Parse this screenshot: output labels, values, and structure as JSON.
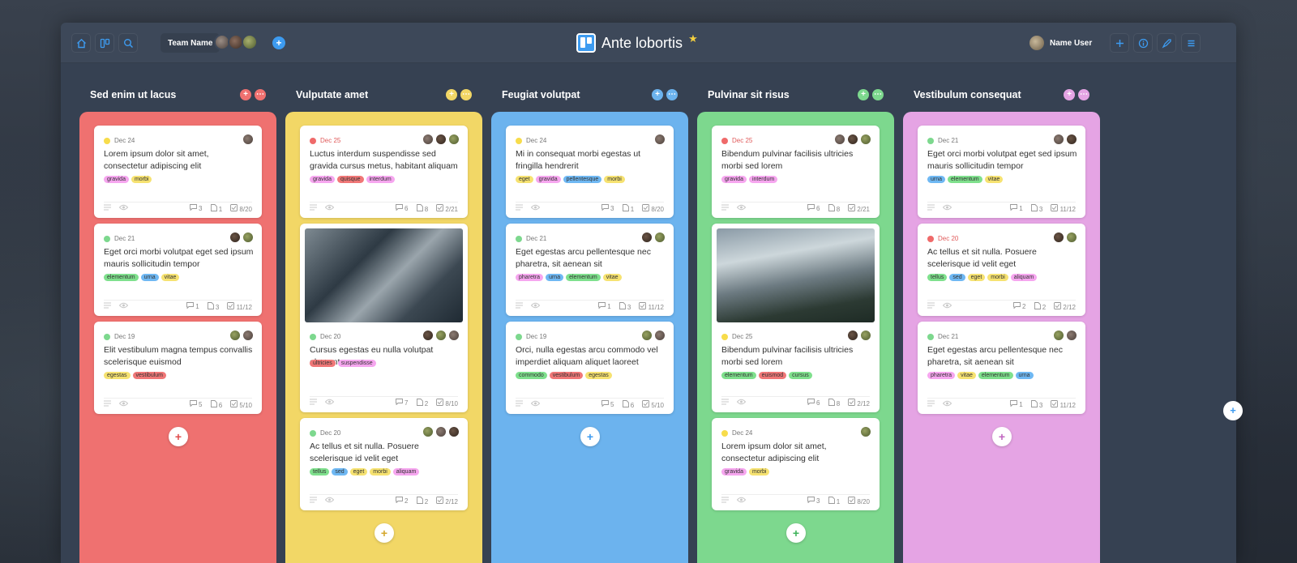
{
  "topbar": {
    "team_name": "Team Name",
    "board_title": "Ante lobortis",
    "user_name": "Name User"
  },
  "colors": {
    "accent": "#3d9bf0",
    "red": "#ef7170",
    "yellow": "#f2d766",
    "blue": "#6cb3ee",
    "green": "#7dd88e",
    "pink": "#e5a4e4"
  },
  "columns": [
    {
      "title": "Sed enim ut lacus",
      "color": "#ef7170",
      "cards": [
        {
          "date": "Dec 24",
          "dot": "#f7dc4b",
          "text": "Lorem ipsum dolor sit amet, consectetur adipiscing elit",
          "tags": [
            "gravida",
            "morbi"
          ],
          "stats": [
            "3",
            "1",
            "8/20"
          ]
        },
        {
          "date": "Dec 21",
          "dot": "#7dd88e",
          "text": "Eget orci morbi volutpat eget sed ipsum mauris sollicitudin tempor",
          "tags": [
            "elementum",
            "urna",
            "vitae"
          ],
          "stats": [
            "1",
            "3",
            "11/12"
          ]
        },
        {
          "date": "Dec 19",
          "dot": "#7dd88e",
          "text": "Elit vestibulum magna tempus convallis scelerisque euismod",
          "tags": [
            "egestas",
            "vestibulum"
          ],
          "stats": [
            "5",
            "6",
            "5/10"
          ]
        }
      ]
    },
    {
      "title": "Vulputate amet",
      "color": "#f2d766",
      "cards": [
        {
          "date": "Dec 25",
          "dot": "#ef6a6a",
          "text": "Luctus interdum suspendisse sed gravida cursus metus, habitant aliquam",
          "tags": [
            "gravida",
            "quisque",
            "interdum"
          ],
          "stats": [
            "6",
            "8",
            "2/21"
          ]
        },
        {
          "date": "Dec 20",
          "dot": "#7dd88e",
          "text": "Cursus egestas eu nulla volutpat elementum",
          "tags": [
            "ultricies",
            "suspendisse"
          ],
          "stats": [
            "7",
            "2",
            "8/10"
          ]
        },
        {
          "date": "Dec 20",
          "dot": "#7dd88e",
          "text": "Ac tellus et sit nulla. Posuere scelerisque id velit eget",
          "tags": [
            "tellus",
            "sed",
            "eget",
            "morbi",
            "aliquam"
          ],
          "stats": [
            "2",
            "2",
            "2/12"
          ]
        }
      ]
    },
    {
      "title": "Feugiat volutpat",
      "color": "#6cb3ee",
      "cards": [
        {
          "date": "Dec 24",
          "dot": "#f7dc4b",
          "text": "Mi in consequat morbi egestas ut fringilla hendrerit",
          "tags": [
            "eget",
            "gravida",
            "pellentesque",
            "morbi"
          ],
          "stats": [
            "3",
            "1",
            "8/20"
          ]
        },
        {
          "date": "Dec 21",
          "dot": "#7dd88e",
          "text": "Eget egestas arcu pellentesque nec pharetra, sit aenean sit",
          "tags": [
            "pharetra",
            "urna",
            "elementum",
            "vitae"
          ],
          "stats": [
            "1",
            "3",
            "11/12"
          ]
        },
        {
          "date": "Dec 19",
          "dot": "#7dd88e",
          "text": "Orci, nulla egestas arcu commodo vel imperdiet aliquam aliquet laoreet",
          "tags": [
            "commodo",
            "vestibulum",
            "egestas"
          ],
          "stats": [
            "5",
            "6",
            "5/10"
          ]
        }
      ]
    },
    {
      "title": "Pulvinar sit risus",
      "color": "#7dd88e",
      "cards": [
        {
          "date": "Dec 25",
          "dot": "#ef6a6a",
          "text": "Bibendum pulvinar facilisis ultricies morbi sed lorem",
          "tags": [
            "gravida",
            "interdum"
          ],
          "stats": [
            "6",
            "8",
            "2/21"
          ]
        },
        {
          "date": "Dec 25",
          "dot": "#f7dc4b",
          "text": "Bibendum pulvinar facilisis ultricies morbi sed lorem",
          "tags": [
            "elementum",
            "euismod",
            "cursus"
          ],
          "stats": [
            "6",
            "8",
            "2/12"
          ]
        },
        {
          "date": "Dec 24",
          "dot": "#f7dc4b",
          "text": "Lorem ipsum dolor sit amet, consectetur adipiscing elit",
          "tags": [
            "gravida",
            "morbi"
          ],
          "stats": [
            "3",
            "1",
            "8/20"
          ]
        }
      ]
    },
    {
      "title": "Vestibulum consequat",
      "color": "#e5a4e4",
      "cards": [
        {
          "date": "Dec 21",
          "dot": "#7dd88e",
          "text": "Eget orci morbi volutpat eget sed ipsum mauris sollicitudin tempor",
          "tags": [
            "urna",
            "elementum",
            "vitae"
          ],
          "stats": [
            "1",
            "3",
            "11/12"
          ]
        },
        {
          "date": "Dec 20",
          "dot": "#ef6a6a",
          "text": "Ac tellus et sit nulla. Posuere scelerisque id velit eget",
          "tags": [
            "tellus",
            "sed",
            "eget",
            "morbi",
            "aliquam"
          ],
          "stats": [
            "2",
            "2",
            "2/12"
          ]
        },
        {
          "date": "Dec 21",
          "dot": "#7dd88e",
          "text": "Eget egestas arcu pellentesque nec pharetra, sit aenean sit",
          "tags": [
            "pharetra",
            "vitae",
            "elementum",
            "urna"
          ],
          "stats": [
            "1",
            "3",
            "11/12"
          ]
        }
      ]
    }
  ],
  "tag_colors": {
    "gravida": "#f6a6ef",
    "morbi": "#f6e271",
    "elementum": "#7fe08d",
    "urna": "#6fb8f3",
    "vitae": "#f6e271",
    "egestas": "#f6e271",
    "vestibulum": "#f07777",
    "quisque": "#f07777",
    "interdum": "#f6a6ef",
    "ultricies": "#f07777",
    "suspendisse": "#f6a6ef",
    "tellus": "#7fe08d",
    "sed": "#6fb8f3",
    "eget": "#f6e271",
    "aliquam": "#f6a6ef",
    "pellentesque": "#6fb8f3",
    "pharetra": "#f6a6ef",
    "commodo": "#7fe08d",
    "euismod": "#f07777",
    "cursus": "#7fe08d"
  },
  "icons": {
    "home": "home-icon",
    "board": "board-icon",
    "search": "search-icon",
    "add": "plus-icon",
    "info": "info-icon",
    "rocket": "rocket-icon",
    "menu": "menu-icon",
    "comment": "comment-icon",
    "file": "file-icon",
    "check": "checklist-icon",
    "description": "description-icon",
    "watch": "eye-icon"
  }
}
